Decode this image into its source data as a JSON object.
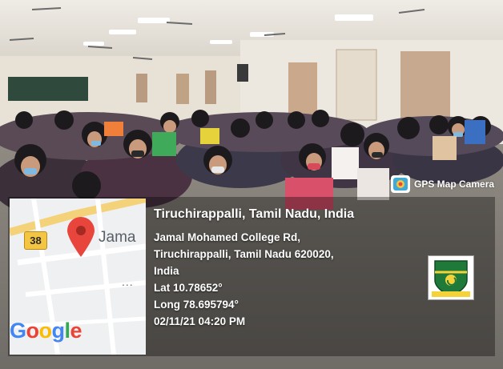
{
  "camera_badge": {
    "label": "GPS Map Camera",
    "icon": "camera-icon"
  },
  "map": {
    "road_number": "38",
    "place_label": "Jama",
    "more_label": "...",
    "pin_icon": "map-pin-icon",
    "logo_letters": [
      "G",
      "o",
      "o",
      "g",
      "l",
      "e"
    ],
    "logo_colors": [
      "#4285F4",
      "#EA4335",
      "#FBBC05",
      "#4285F4",
      "#34A853",
      "#EA4335"
    ]
  },
  "location": {
    "title": "Tiruchirappalli, Tamil Nadu, India",
    "address_line1": "Jamal Mohamed College Rd,",
    "address_line2": "Tiruchirappalli, Tamil Nadu 620020,",
    "address_line3": "India",
    "latitude": "Lat 10.78652°",
    "longitude": "Long 78.695794°",
    "datetime": "02/11/21 04:20 PM"
  },
  "college_logo": {
    "icon": "college-crest-icon"
  }
}
